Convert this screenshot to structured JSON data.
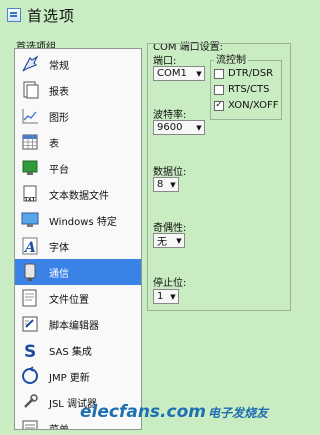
{
  "window": {
    "title": "首选项"
  },
  "preferences": {
    "group_label": "首选项组",
    "items": [
      {
        "label": "常规",
        "icon": "general-icon"
      },
      {
        "label": "报表",
        "icon": "report-icon"
      },
      {
        "label": "图形",
        "icon": "graph-icon"
      },
      {
        "label": "表",
        "icon": "table-icon"
      },
      {
        "label": "平台",
        "icon": "platform-icon"
      },
      {
        "label": "文本数据文件",
        "icon": "text-file-icon"
      },
      {
        "label": "Windows 特定",
        "icon": "windows-icon"
      },
      {
        "label": "字体",
        "icon": "font-icon"
      },
      {
        "label": "通信",
        "icon": "communication-icon"
      },
      {
        "label": "文件位置",
        "icon": "folder-icon"
      },
      {
        "label": "脚本编辑器",
        "icon": "script-editor-icon"
      },
      {
        "label": "SAS 集成",
        "icon": "sas-icon"
      },
      {
        "label": "JMP 更新",
        "icon": "update-icon"
      },
      {
        "label": "JSL 调试器",
        "icon": "debugger-icon"
      },
      {
        "label": "菜单",
        "icon": "menu-icon"
      }
    ],
    "selected": "通信"
  },
  "com_settings": {
    "title": "COM 端口设置:",
    "port_label": "端口:",
    "port_value": "COM1",
    "baud_label": "波特率:",
    "baud_value": "9600",
    "databits_label": "数据位:",
    "databits_value": "8",
    "parity_label": "奇偶性:",
    "parity_value": "无",
    "stopbits_label": "停止位:",
    "stopbits_value": "1",
    "flow_control": {
      "title": "流控制",
      "options": [
        {
          "label": "DTR/DSR",
          "checked": false
        },
        {
          "label": "RTS/CTS",
          "checked": false
        },
        {
          "label": "XON/XOFF",
          "checked": true
        }
      ]
    }
  },
  "watermark": {
    "text": "elecfans.com",
    "cn": "电子发烧友"
  },
  "colors": {
    "background": "#c9ecc2",
    "selection": "#3b82e6"
  }
}
